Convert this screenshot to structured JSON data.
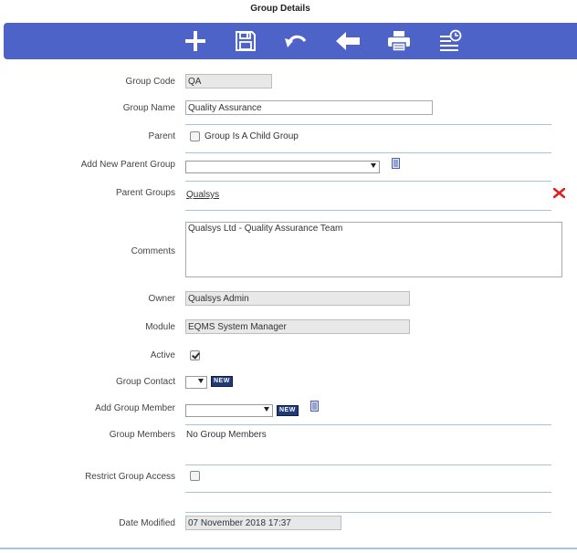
{
  "page_title": "Group Details",
  "toolbar": {
    "icons": [
      "add-icon",
      "save-icon",
      "undo-icon",
      "back-icon",
      "print-icon",
      "history-icon"
    ],
    "color": "#4d63c7"
  },
  "form": {
    "group_code": {
      "label": "Group Code",
      "value": "QA"
    },
    "group_name": {
      "label": "Group Name",
      "value": "Quality Assurance"
    },
    "parent": {
      "label": "Parent",
      "checkbox_label": "Group Is A Child Group",
      "checked": false
    },
    "add_new_parent_group": {
      "label": "Add New Parent Group",
      "value": ""
    },
    "parent_groups": {
      "label": "Parent Groups",
      "value": "Qualsys"
    },
    "comments": {
      "label": "Comments",
      "value": "Qualsys Ltd - Quality Assurance Team"
    },
    "owner": {
      "label": "Owner",
      "value": "Qualsys Admin"
    },
    "module": {
      "label": "Module",
      "value": "EQMS System Manager"
    },
    "active": {
      "label": "Active",
      "checked": true
    },
    "group_contact": {
      "label": "Group Contact",
      "new_badge": "NEW"
    },
    "add_group_member": {
      "label": "Add Group Member",
      "new_badge": "NEW"
    },
    "group_members": {
      "label": "Group Members",
      "value": "No Group Members"
    },
    "restrict_group_access": {
      "label": "Restrict Group Access",
      "checked": false
    },
    "date_modified": {
      "label": "Date Modified",
      "value": "07 November 2018 17:37"
    }
  }
}
